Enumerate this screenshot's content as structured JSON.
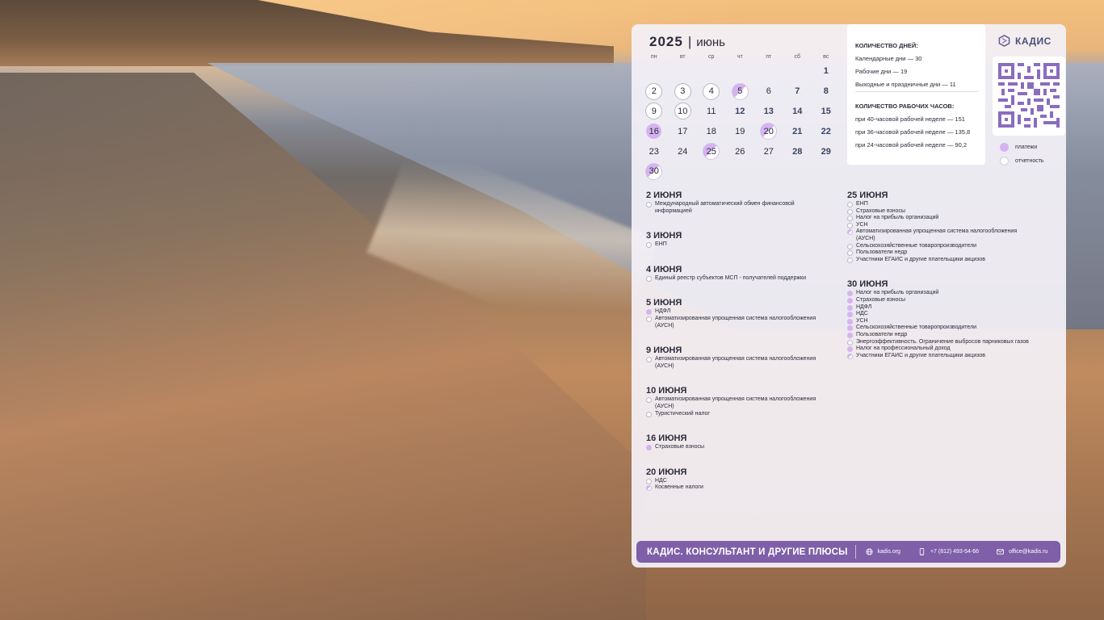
{
  "calendar": {
    "year": "2025",
    "separator": "|",
    "month": "июнь",
    "weekdays": [
      "пн",
      "вт",
      "ср",
      "чт",
      "пт",
      "сб",
      "вс"
    ],
    "days": [
      {
        "d": "",
        "c": ""
      },
      {
        "d": "",
        "c": ""
      },
      {
        "d": "",
        "c": ""
      },
      {
        "d": "",
        "c": ""
      },
      {
        "d": "",
        "c": ""
      },
      {
        "d": "",
        "c": ""
      },
      {
        "d": "1",
        "c": "wk"
      },
      {
        "d": "2",
        "c": "ring"
      },
      {
        "d": "3",
        "c": "ring"
      },
      {
        "d": "4",
        "c": "ring"
      },
      {
        "d": "5",
        "c": "half"
      },
      {
        "d": "6",
        "c": ""
      },
      {
        "d": "7",
        "c": "wk"
      },
      {
        "d": "8",
        "c": "wk"
      },
      {
        "d": "9",
        "c": "ring"
      },
      {
        "d": "10",
        "c": "ring"
      },
      {
        "d": "11",
        "c": ""
      },
      {
        "d": "12",
        "c": "wk"
      },
      {
        "d": "13",
        "c": "wk"
      },
      {
        "d": "14",
        "c": "wk"
      },
      {
        "d": "15",
        "c": "wk"
      },
      {
        "d": "16",
        "c": "pay"
      },
      {
        "d": "17",
        "c": ""
      },
      {
        "d": "18",
        "c": ""
      },
      {
        "d": "19",
        "c": ""
      },
      {
        "d": "20",
        "c": "half"
      },
      {
        "d": "21",
        "c": "wk"
      },
      {
        "d": "22",
        "c": "wk"
      },
      {
        "d": "23",
        "c": ""
      },
      {
        "d": "24",
        "c": ""
      },
      {
        "d": "25",
        "c": "half"
      },
      {
        "d": "26",
        "c": ""
      },
      {
        "d": "27",
        "c": ""
      },
      {
        "d": "28",
        "c": "wk"
      },
      {
        "d": "29",
        "c": "wk"
      },
      {
        "d": "30",
        "c": "half"
      }
    ]
  },
  "stats": {
    "days_title": "КОЛИЧЕСТВО ДНЕЙ:",
    "calendar_days": "Календарные дни — 30",
    "work_days": "Рабочие дни — 19",
    "holidays": "Выходные и праздничные дни — 11",
    "hours_title": "КОЛИЧЕСТВО РАБОЧИХ ЧАСОВ:",
    "h40": "при 40-часовой рабочей неделе — 151",
    "h36": "при 36-часовой рабочей неделе — 135,8",
    "h24": "при 24-часовой рабочей неделе — 90,2"
  },
  "brand": {
    "logo": "КАДИС",
    "accent": "#7e5fa8",
    "payment_color": "#d6b3f0"
  },
  "legend": {
    "payments": "платежи",
    "reports": "отчетность"
  },
  "schedule_left": [
    {
      "date": "2 ИЮНЯ",
      "items": [
        {
          "t": "Международный автоматический обмен финансовой информацией",
          "m": "r"
        }
      ]
    },
    {
      "date": "3 ИЮНЯ",
      "items": [
        {
          "t": "ЕНП",
          "m": "r"
        }
      ]
    },
    {
      "date": "4 ИЮНЯ",
      "items": [
        {
          "t": "Единый реестр субъектов МСП - получателей поддержки",
          "m": "r"
        }
      ]
    },
    {
      "date": "5 ИЮНЯ",
      "items": [
        {
          "t": "НДФЛ",
          "m": "p"
        },
        {
          "t": "Автоматизированная упрощенная система налогообложения (АУСН)",
          "m": "r"
        }
      ]
    },
    {
      "date": "9 ИЮНЯ",
      "items": [
        {
          "t": "Автоматизированная упрощенная система налогообложения (АУСН)",
          "m": "r"
        }
      ]
    },
    {
      "date": "10 ИЮНЯ",
      "items": [
        {
          "t": "Автоматизированная упрощенная система налогообложения (АУСН)",
          "m": "r"
        },
        {
          "t": "Туристический налог",
          "m": "r"
        }
      ]
    },
    {
      "date": "16 ИЮНЯ",
      "items": [
        {
          "t": "Страховые взносы",
          "m": "p"
        }
      ]
    },
    {
      "date": "20 ИЮНЯ",
      "items": [
        {
          "t": "НДС",
          "m": "r"
        },
        {
          "t": "Косвенные налоги",
          "m": "h"
        }
      ]
    }
  ],
  "schedule_right": [
    {
      "date": "25 ИЮНЯ",
      "items": [
        {
          "t": "ЕНП",
          "m": "r"
        },
        {
          "t": "Страховые взносы",
          "m": "r"
        },
        {
          "t": "Налог на прибыль организаций",
          "m": "r"
        },
        {
          "t": "УСН",
          "m": "r"
        },
        {
          "t": "Автоматизированная упрощенная система налогообложения (АУСН)",
          "m": "h"
        },
        {
          "t": "Сельскохозяйственные товаропроизводители",
          "m": "r"
        },
        {
          "t": "Пользователи недр",
          "m": "r"
        },
        {
          "t": "Участники ЕГАИС и другие плательщики акцизов",
          "m": "r"
        }
      ]
    },
    {
      "date": "30 ИЮНЯ",
      "items": [
        {
          "t": "Налог на прибыль организаций",
          "m": "p"
        },
        {
          "t": "Страховые взносы",
          "m": "p"
        },
        {
          "t": "НДФЛ",
          "m": "p"
        },
        {
          "t": "НДС",
          "m": "p"
        },
        {
          "t": "УСН",
          "m": "p"
        },
        {
          "t": "Сельскохозяйственные товаропроизводители",
          "m": "p"
        },
        {
          "t": "Пользователи недр",
          "m": "p"
        },
        {
          "t": "Энергоэффективность. Ограничение выбросов парниковых газов",
          "m": "r"
        },
        {
          "t": "Налог на профессиональный доход",
          "m": "p"
        },
        {
          "t": "Участники ЕГАИС и другие плательщики акцизов",
          "m": "h"
        }
      ]
    }
  ],
  "footer": {
    "title": "КАДИС. КОНСУЛЬТАНТ И ДРУГИЕ ПЛЮСЫ",
    "site": "kadis.org",
    "phone": "+7 (812) 493-54-66",
    "email": "office@kadis.ru"
  }
}
